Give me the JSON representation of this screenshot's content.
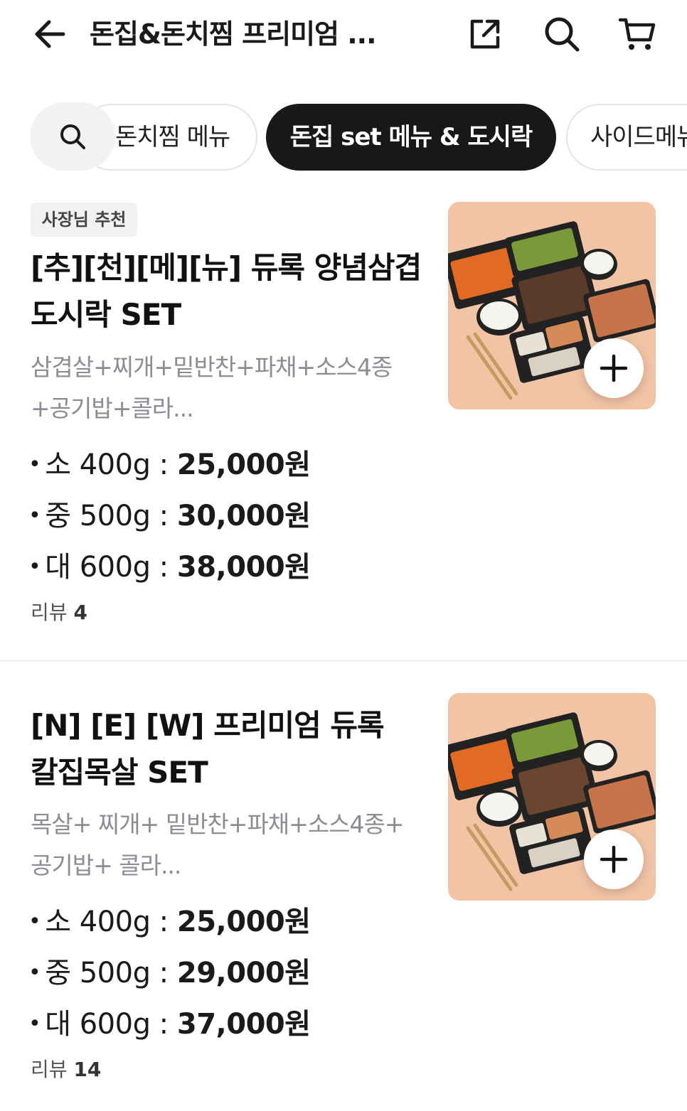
{
  "header": {
    "title": "돈집&돈치찜 프리미엄 ..."
  },
  "chips": {
    "items": [
      "돈치찜 메뉴",
      "돈집 set 메뉴 & 도시락",
      "사이드메뉴"
    ]
  },
  "menu": {
    "items": [
      {
        "badge": "사장님 추천",
        "name_line1": "[추][천][메][뉴] 듀록 양념삼겹",
        "name_line2": "도시락 SET",
        "desc_line1": "삼겹살+찌개+밑반찬+파채+소스4종",
        "desc_line2": "+공기밥+콜라...",
        "prices": [
          {
            "size": "소 400g : ",
            "amount": "25,000원"
          },
          {
            "size": "중 500g : ",
            "amount": "30,000원"
          },
          {
            "size": "대 600g : ",
            "amount": "38,000원"
          }
        ],
        "review_label": "리뷰",
        "review_count": "4"
      },
      {
        "name_line1": "[N] [E] [W] 프리미엄 듀록",
        "name_line2": "칼집목살 SET",
        "desc_line1": "목살+ 찌개+ 밑반찬+파채+소스4종+",
        "desc_line2": "공기밥+ 콜라...",
        "prices": [
          {
            "size": "소 400g : ",
            "amount": "25,000원"
          },
          {
            "size": "중 500g : ",
            "amount": "29,000원"
          },
          {
            "size": "대 600g : ",
            "amount": "37,000원"
          }
        ],
        "review_label": "리뷰",
        "review_count": "14"
      }
    ]
  }
}
